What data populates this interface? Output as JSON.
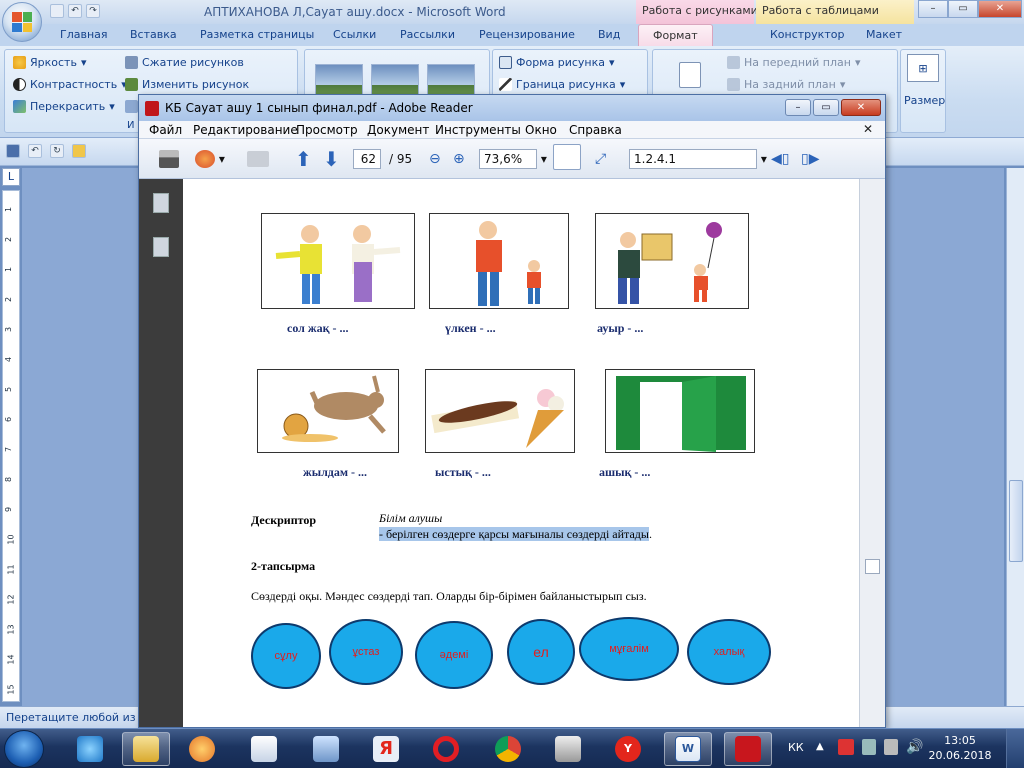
{
  "word": {
    "title": "АПТИХАНОВА Л,Сауат ашу.docx - Microsoft Word",
    "context_tabs": {
      "pictures": "Работа с рисунками",
      "tables": "Работа с таблицами"
    },
    "tabs": [
      "Главная",
      "Вставка",
      "Разметка страницы",
      "Ссылки",
      "Рассылки",
      "Рецензирование",
      "Вид",
      "Формат",
      "Конструктор",
      "Макет"
    ],
    "active_tab": "Формат",
    "ribbon": {
      "brightness": "Яркость",
      "contrast": "Контрастность",
      "recolor": "Перекрасить",
      "compress": "Сжатие рисунков",
      "change": "Изменить рисунок",
      "shape": "Форма рисунка",
      "border": "Граница рисунка",
      "to_front": "На передний план",
      "to_back": "На задний план",
      "size": "Размер",
      "group_cut": "И"
    },
    "ruler_corner": "L",
    "ruler_numbers": [
      "1",
      "2",
      "1",
      "2",
      "3",
      "4",
      "5",
      "6",
      "7",
      "8",
      "9",
      "10",
      "11",
      "12",
      "13",
      "14",
      "15"
    ],
    "status": "Перетащите любой из с"
  },
  "reader": {
    "title": "КБ Сауат ашу 1 сынып финал.pdf - Adobe Reader",
    "menu": [
      "Файл",
      "Редактирование",
      "Просмотр",
      "Документ",
      "Инструменты",
      "Окно",
      "Справка"
    ],
    "page_current": "62",
    "page_total": "/ 95",
    "zoom": "73,6%",
    "find": "1.2.4.1",
    "content": {
      "row1_captions": [
        "сол жақ - ...",
        "үлкен -  ...",
        "ауыр  -  ..."
      ],
      "row2_captions": [
        "жылдам  -  ...",
        "ыстық  -  ...",
        "ашық  -  ..."
      ],
      "descriptor_label": "Дескриптор",
      "descriptor_title": "Білім алушы",
      "descriptor_text": "- берілген сөздерге  қарсы мағыналы сөздерді айтады",
      "descriptor_dot": ".",
      "task2": "2-тапсырма",
      "task2_text": "Сөздерді оқы. Мәндес сөздерді тап.  Оларды бір-бірімен байланыстырып  сыз.",
      "ovals": [
        "сұлу",
        "ұстаз",
        "әдемі",
        "ел",
        "мұғалім",
        "халық"
      ]
    }
  },
  "taskbar": {
    "lang": "КК",
    "time": "13:05",
    "date": "20.06.2018"
  },
  "colors": {
    "ribbon_bg": "#cadcf1",
    "format_tab": "#f7dbe8",
    "oval_fill": "#1aa9ea",
    "oval_text": "#e41d1d",
    "highlight": "#a7c6ea"
  }
}
